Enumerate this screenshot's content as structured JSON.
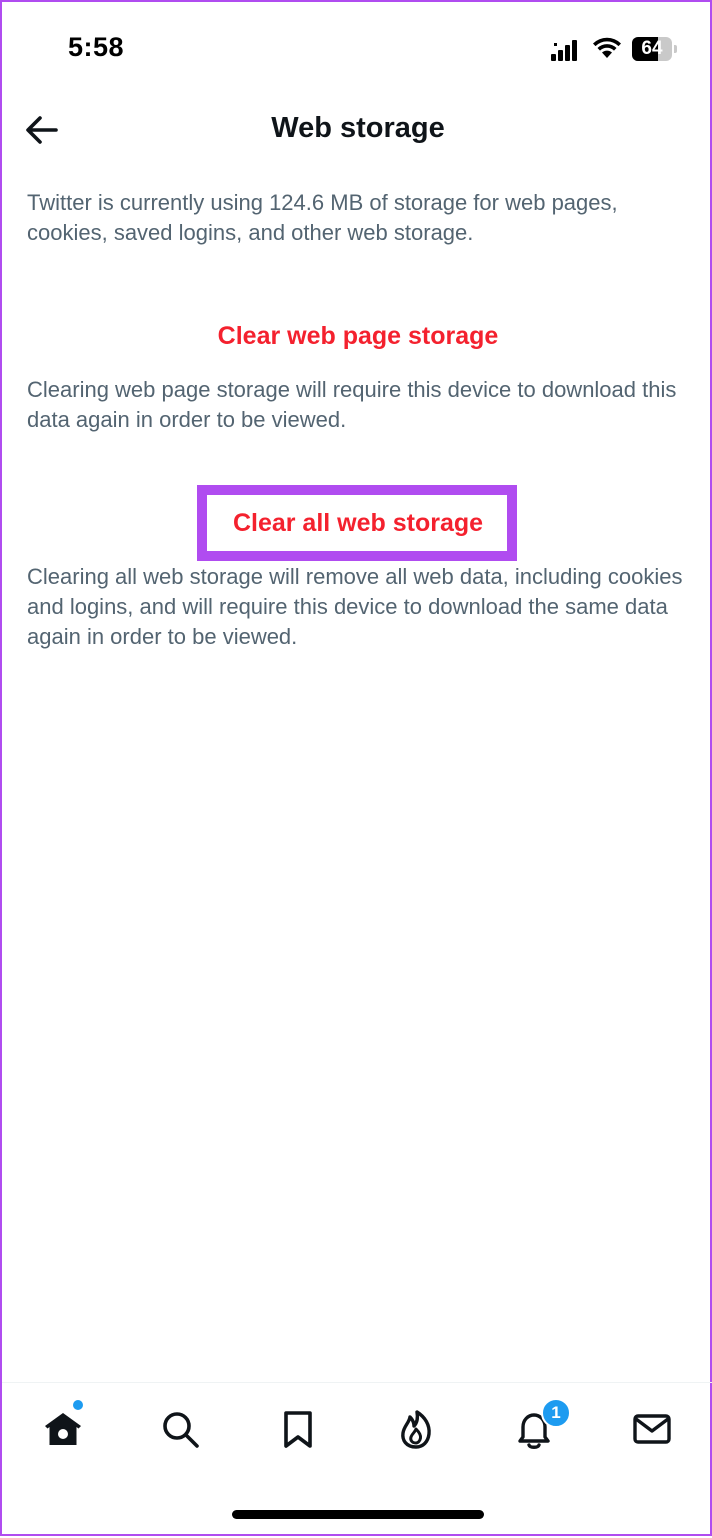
{
  "status_bar": {
    "time": "5:58",
    "battery_level": 64,
    "battery_text": "64",
    "icons": [
      "signal-icon",
      "wifi-icon",
      "battery-icon"
    ]
  },
  "header": {
    "title": "Web storage",
    "back_icon": "arrow-left-icon"
  },
  "content": {
    "intro": "Twitter is currently using 124.6 MB of storage for web pages, cookies, saved logins, and other web storage.",
    "clear_page_label": "Clear web page storage",
    "clear_page_desc": "Clearing web page storage will require this device to download this data again in order to be viewed.",
    "clear_all_label": "Clear all web storage",
    "clear_all_desc": "Clearing all web storage will remove all web data, including cookies and logins, and will require this device to download the same data again in order to be viewed."
  },
  "bottom_nav": {
    "items": [
      {
        "icon": "home-icon",
        "active": true,
        "dot": true
      },
      {
        "icon": "search-icon"
      },
      {
        "icon": "bookmark-icon"
      },
      {
        "icon": "flame-icon"
      },
      {
        "icon": "bell-icon",
        "badge": "1"
      },
      {
        "icon": "mail-icon"
      }
    ],
    "notification_badge": "1"
  },
  "colors": {
    "accent_red": "#f4212e",
    "highlight_purple": "#b04cf0",
    "text_secondary": "#536471",
    "text_primary": "#0f1419",
    "badge_blue": "#1d9bf0"
  }
}
